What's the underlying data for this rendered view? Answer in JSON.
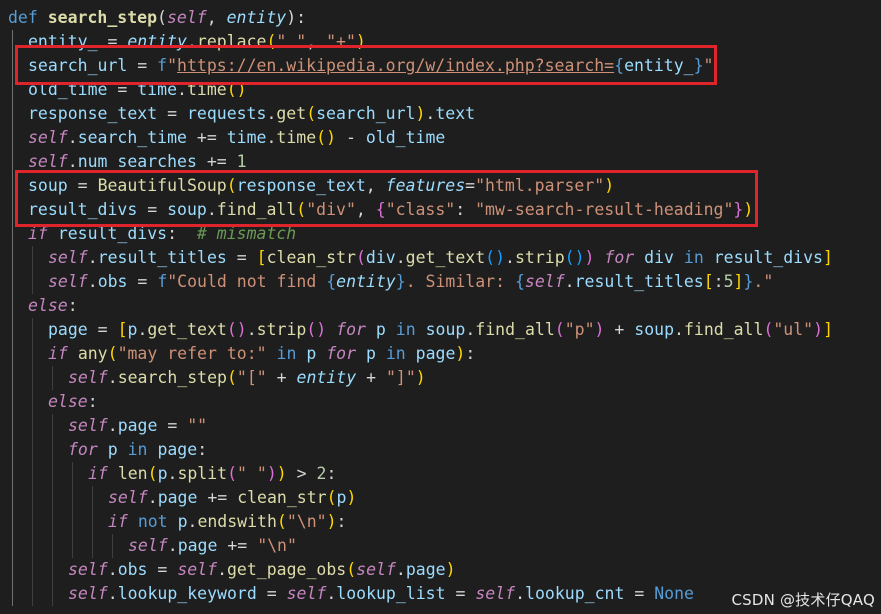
{
  "editor": {
    "lines": [
      {
        "indent": 0,
        "tokens": [
          [
            "kw",
            "def "
          ],
          [
            "fnb",
            "search_step"
          ],
          [
            "op",
            "("
          ],
          [
            "self",
            "self"
          ],
          [
            "op",
            ", "
          ],
          [
            "param",
            "entity"
          ],
          [
            "op",
            "):"
          ]
        ]
      },
      {
        "indent": 1,
        "tokens": [
          [
            "var",
            "entity_"
          ],
          [
            "op",
            " = "
          ],
          [
            "param",
            "entity"
          ],
          [
            "op",
            "."
          ],
          [
            "fn",
            "replace"
          ],
          [
            "br1",
            "("
          ],
          [
            "str",
            "\" \""
          ],
          [
            "op",
            ", "
          ],
          [
            "str",
            "\"+\""
          ],
          [
            "br1",
            ")"
          ]
        ]
      },
      {
        "indent": 1,
        "tokens": [
          [
            "var",
            "search_url"
          ],
          [
            "op",
            " = "
          ],
          [
            "kw",
            "f"
          ],
          [
            "str",
            "\""
          ],
          [
            "url",
            "https://en.wikipedia.org/w/index.php?search="
          ],
          [
            "kw",
            "{"
          ],
          [
            "var",
            "entity_"
          ],
          [
            "kw",
            "}"
          ],
          [
            "str",
            "\""
          ]
        ]
      },
      {
        "indent": 1,
        "tokens": [
          [
            "var",
            "old_time"
          ],
          [
            "op",
            " = "
          ],
          [
            "var",
            "time"
          ],
          [
            "op",
            "."
          ],
          [
            "fn",
            "time"
          ],
          [
            "br1",
            "()"
          ]
        ]
      },
      {
        "indent": 1,
        "tokens": [
          [
            "var",
            "response_text"
          ],
          [
            "op",
            " = "
          ],
          [
            "var",
            "requests"
          ],
          [
            "op",
            "."
          ],
          [
            "fn",
            "get"
          ],
          [
            "br1",
            "("
          ],
          [
            "var",
            "search_url"
          ],
          [
            "br1",
            ")"
          ],
          [
            "op",
            "."
          ],
          [
            "var",
            "text"
          ]
        ]
      },
      {
        "indent": 1,
        "tokens": [
          [
            "self",
            "self"
          ],
          [
            "op",
            "."
          ],
          [
            "var",
            "search_time"
          ],
          [
            "op",
            " += "
          ],
          [
            "var",
            "time"
          ],
          [
            "op",
            "."
          ],
          [
            "fn",
            "time"
          ],
          [
            "br1",
            "()"
          ],
          [
            "op",
            " - "
          ],
          [
            "var",
            "old_time"
          ]
        ]
      },
      {
        "indent": 1,
        "tokens": [
          [
            "self",
            "self"
          ],
          [
            "op",
            "."
          ],
          [
            "var",
            "num_searches"
          ],
          [
            "op",
            " += "
          ],
          [
            "num",
            "1"
          ]
        ]
      },
      {
        "indent": 1,
        "tokens": [
          [
            "var",
            "soup"
          ],
          [
            "op",
            " = "
          ],
          [
            "fn",
            "BeautifulSoup"
          ],
          [
            "br1",
            "("
          ],
          [
            "var",
            "response_text"
          ],
          [
            "op",
            ", "
          ],
          [
            "param",
            "features"
          ],
          [
            "op",
            "="
          ],
          [
            "str",
            "\"html.parser\""
          ],
          [
            "br1",
            ")"
          ]
        ]
      },
      {
        "indent": 1,
        "tokens": [
          [
            "var",
            "result_divs"
          ],
          [
            "op",
            " = "
          ],
          [
            "var",
            "soup"
          ],
          [
            "op",
            "."
          ],
          [
            "fn",
            "find_all"
          ],
          [
            "br1",
            "("
          ],
          [
            "str",
            "\"div\""
          ],
          [
            "op",
            ", "
          ],
          [
            "br2",
            "{"
          ],
          [
            "str",
            "\"class\""
          ],
          [
            "op",
            ": "
          ],
          [
            "str",
            "\"mw-search-result-heading\""
          ],
          [
            "br2",
            "}"
          ],
          [
            "br1",
            ")"
          ]
        ]
      },
      {
        "indent": 1,
        "tokens": [
          [
            "kwi",
            "if"
          ],
          [
            "op",
            " "
          ],
          [
            "var",
            "result_divs"
          ],
          [
            "op",
            ":  "
          ],
          [
            "cm",
            "# mismatch"
          ]
        ]
      },
      {
        "indent": 2,
        "tokens": [
          [
            "self",
            "self"
          ],
          [
            "op",
            "."
          ],
          [
            "var",
            "result_titles"
          ],
          [
            "op",
            " = "
          ],
          [
            "br1",
            "["
          ],
          [
            "fn",
            "clean_str"
          ],
          [
            "br2",
            "("
          ],
          [
            "var",
            "div"
          ],
          [
            "op",
            "."
          ],
          [
            "fn",
            "get_text"
          ],
          [
            "br3",
            "()"
          ],
          [
            "op",
            "."
          ],
          [
            "fn",
            "strip"
          ],
          [
            "br3",
            "()"
          ],
          [
            "br2",
            ")"
          ],
          [
            "op",
            " "
          ],
          [
            "kwi",
            "for"
          ],
          [
            "op",
            " "
          ],
          [
            "var",
            "div"
          ],
          [
            "op",
            " "
          ],
          [
            "kw",
            "in"
          ],
          [
            "op",
            " "
          ],
          [
            "var",
            "result_divs"
          ],
          [
            "br1",
            "]"
          ]
        ]
      },
      {
        "indent": 2,
        "tokens": [
          [
            "self",
            "self"
          ],
          [
            "op",
            "."
          ],
          [
            "var",
            "obs"
          ],
          [
            "op",
            " = "
          ],
          [
            "kw",
            "f"
          ],
          [
            "str",
            "\"Could not find "
          ],
          [
            "kw",
            "{"
          ],
          [
            "param",
            "entity"
          ],
          [
            "kw",
            "}"
          ],
          [
            "str",
            ". Similar: "
          ],
          [
            "kw",
            "{"
          ],
          [
            "self",
            "self"
          ],
          [
            "op",
            "."
          ],
          [
            "var",
            "result_titles"
          ],
          [
            "br1",
            "["
          ],
          [
            "op",
            ":"
          ],
          [
            "num",
            "5"
          ],
          [
            "br1",
            "]"
          ],
          [
            "kw",
            "}"
          ],
          [
            "str",
            ".\""
          ]
        ]
      },
      {
        "indent": 1,
        "tokens": [
          [
            "kwi",
            "else"
          ],
          [
            "op",
            ":"
          ]
        ]
      },
      {
        "indent": 2,
        "tokens": [
          [
            "var",
            "page"
          ],
          [
            "op",
            " = "
          ],
          [
            "br1",
            "["
          ],
          [
            "var",
            "p"
          ],
          [
            "op",
            "."
          ],
          [
            "fn",
            "get_text"
          ],
          [
            "br2",
            "()"
          ],
          [
            "op",
            "."
          ],
          [
            "fn",
            "strip"
          ],
          [
            "br2",
            "()"
          ],
          [
            "op",
            " "
          ],
          [
            "kwi",
            "for"
          ],
          [
            "op",
            " "
          ],
          [
            "var",
            "p"
          ],
          [
            "op",
            " "
          ],
          [
            "kw",
            "in"
          ],
          [
            "op",
            " "
          ],
          [
            "var",
            "soup"
          ],
          [
            "op",
            "."
          ],
          [
            "fn",
            "find_all"
          ],
          [
            "br2",
            "("
          ],
          [
            "str",
            "\"p\""
          ],
          [
            "br2",
            ")"
          ],
          [
            "op",
            " + "
          ],
          [
            "var",
            "soup"
          ],
          [
            "op",
            "."
          ],
          [
            "fn",
            "find_all"
          ],
          [
            "br2",
            "("
          ],
          [
            "str",
            "\"ul\""
          ],
          [
            "br2",
            ")"
          ],
          [
            "br1",
            "]"
          ]
        ]
      },
      {
        "indent": 2,
        "tokens": [
          [
            "kwi",
            "if"
          ],
          [
            "op",
            " "
          ],
          [
            "fn",
            "any"
          ],
          [
            "br1",
            "("
          ],
          [
            "str",
            "\"may refer to:\""
          ],
          [
            "op",
            " "
          ],
          [
            "kw",
            "in"
          ],
          [
            "op",
            " "
          ],
          [
            "var",
            "p"
          ],
          [
            "op",
            " "
          ],
          [
            "kwi",
            "for"
          ],
          [
            "op",
            " "
          ],
          [
            "var",
            "p"
          ],
          [
            "op",
            " "
          ],
          [
            "kw",
            "in"
          ],
          [
            "op",
            " "
          ],
          [
            "var",
            "page"
          ],
          [
            "br1",
            ")"
          ],
          [
            "op",
            ":"
          ]
        ]
      },
      {
        "indent": 3,
        "tokens": [
          [
            "self",
            "self"
          ],
          [
            "op",
            "."
          ],
          [
            "fn",
            "search_step"
          ],
          [
            "br1",
            "("
          ],
          [
            "str",
            "\"[\""
          ],
          [
            "op",
            " + "
          ],
          [
            "param",
            "entity"
          ],
          [
            "op",
            " + "
          ],
          [
            "str",
            "\"]\""
          ],
          [
            "br1",
            ")"
          ]
        ]
      },
      {
        "indent": 2,
        "tokens": [
          [
            "kwi",
            "else"
          ],
          [
            "op",
            ":"
          ]
        ]
      },
      {
        "indent": 3,
        "tokens": [
          [
            "self",
            "self"
          ],
          [
            "op",
            "."
          ],
          [
            "var",
            "page"
          ],
          [
            "op",
            " = "
          ],
          [
            "str",
            "\"\""
          ]
        ]
      },
      {
        "indent": 3,
        "tokens": [
          [
            "kwi",
            "for"
          ],
          [
            "op",
            " "
          ],
          [
            "var",
            "p"
          ],
          [
            "op",
            " "
          ],
          [
            "kw",
            "in"
          ],
          [
            "op",
            " "
          ],
          [
            "var",
            "page"
          ],
          [
            "op",
            ":"
          ]
        ]
      },
      {
        "indent": 4,
        "tokens": [
          [
            "kwi",
            "if"
          ],
          [
            "op",
            " "
          ],
          [
            "fn",
            "len"
          ],
          [
            "br1",
            "("
          ],
          [
            "var",
            "p"
          ],
          [
            "op",
            "."
          ],
          [
            "fn",
            "split"
          ],
          [
            "br2",
            "("
          ],
          [
            "str",
            "\" \""
          ],
          [
            "br2",
            ")"
          ],
          [
            "br1",
            ")"
          ],
          [
            "op",
            " > "
          ],
          [
            "num",
            "2"
          ],
          [
            "op",
            ":"
          ]
        ]
      },
      {
        "indent": 5,
        "tokens": [
          [
            "self",
            "self"
          ],
          [
            "op",
            "."
          ],
          [
            "var",
            "page"
          ],
          [
            "op",
            " += "
          ],
          [
            "fn",
            "clean_str"
          ],
          [
            "br1",
            "("
          ],
          [
            "var",
            "p"
          ],
          [
            "br1",
            ")"
          ]
        ]
      },
      {
        "indent": 5,
        "tokens": [
          [
            "kwi",
            "if"
          ],
          [
            "op",
            " "
          ],
          [
            "kw",
            "not"
          ],
          [
            "op",
            " "
          ],
          [
            "var",
            "p"
          ],
          [
            "op",
            "."
          ],
          [
            "fn",
            "endswith"
          ],
          [
            "br1",
            "("
          ],
          [
            "str",
            "\"\\n\""
          ],
          [
            "br1",
            ")"
          ],
          [
            "op",
            ":"
          ]
        ]
      },
      {
        "indent": 6,
        "tokens": [
          [
            "self",
            "self"
          ],
          [
            "op",
            "."
          ],
          [
            "var",
            "page"
          ],
          [
            "op",
            " += "
          ],
          [
            "str",
            "\"\\n\""
          ]
        ]
      },
      {
        "indent": 3,
        "tokens": [
          [
            "self",
            "self"
          ],
          [
            "op",
            "."
          ],
          [
            "var",
            "obs"
          ],
          [
            "op",
            " = "
          ],
          [
            "self",
            "self"
          ],
          [
            "op",
            "."
          ],
          [
            "fn",
            "get_page_obs"
          ],
          [
            "br1",
            "("
          ],
          [
            "self",
            "self"
          ],
          [
            "op",
            "."
          ],
          [
            "var",
            "page"
          ],
          [
            "br1",
            ")"
          ]
        ]
      },
      {
        "indent": 3,
        "tokens": [
          [
            "self",
            "self"
          ],
          [
            "op",
            "."
          ],
          [
            "var",
            "lookup_keyword"
          ],
          [
            "op",
            " = "
          ],
          [
            "self",
            "self"
          ],
          [
            "op",
            "."
          ],
          [
            "var",
            "lookup_list"
          ],
          [
            "op",
            " = "
          ],
          [
            "self",
            "self"
          ],
          [
            "op",
            "."
          ],
          [
            "var",
            "lookup_cnt"
          ],
          [
            "op",
            " = "
          ],
          [
            "none",
            "None"
          ]
        ]
      }
    ]
  },
  "annotations": {
    "box_color": "#e0242b",
    "boxes": [
      {
        "name": "highlight-search-url"
      },
      {
        "name": "highlight-soup-parse"
      }
    ]
  },
  "watermark": {
    "text": "CSDN @技术仔QAQ"
  }
}
